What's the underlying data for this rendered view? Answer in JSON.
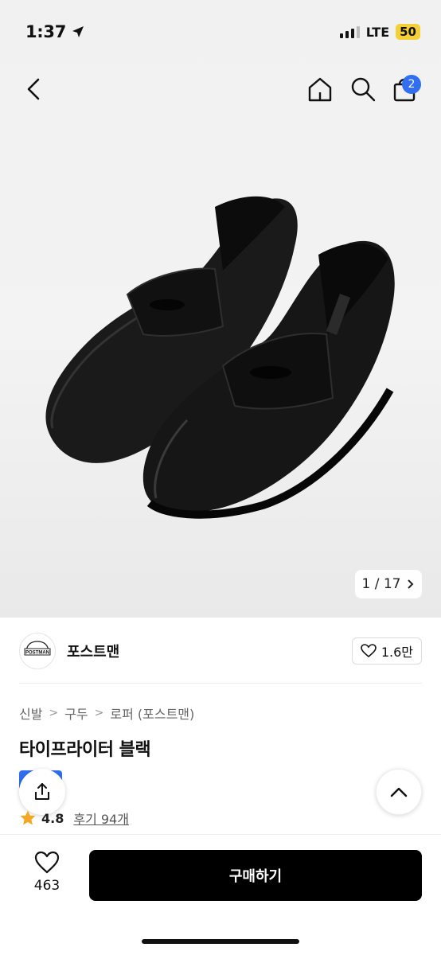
{
  "status": {
    "time": "1:37",
    "network": "LTE",
    "battery": "50"
  },
  "nav": {
    "icons": [
      "back-icon",
      "home-icon",
      "search-icon",
      "shopping-bag-icon"
    ],
    "cart_count": "2"
  },
  "gallery": {
    "counter": "1 / 17"
  },
  "brand": {
    "logo_text": "POSTMAN",
    "name": "포스트맨",
    "likes": "1.6만"
  },
  "breadcrumb": [
    "신발",
    "구두",
    "로퍼 (포스트맨)"
  ],
  "product": {
    "title": "타이프라이터 블랙",
    "rating": "4.8",
    "reviews": "후기 94개"
  },
  "bottom": {
    "wish_count": "463",
    "buy_label": "구매하기"
  },
  "colors": {
    "accent": "#2f6ff0",
    "star": "#f5a623",
    "button": "#000000"
  }
}
